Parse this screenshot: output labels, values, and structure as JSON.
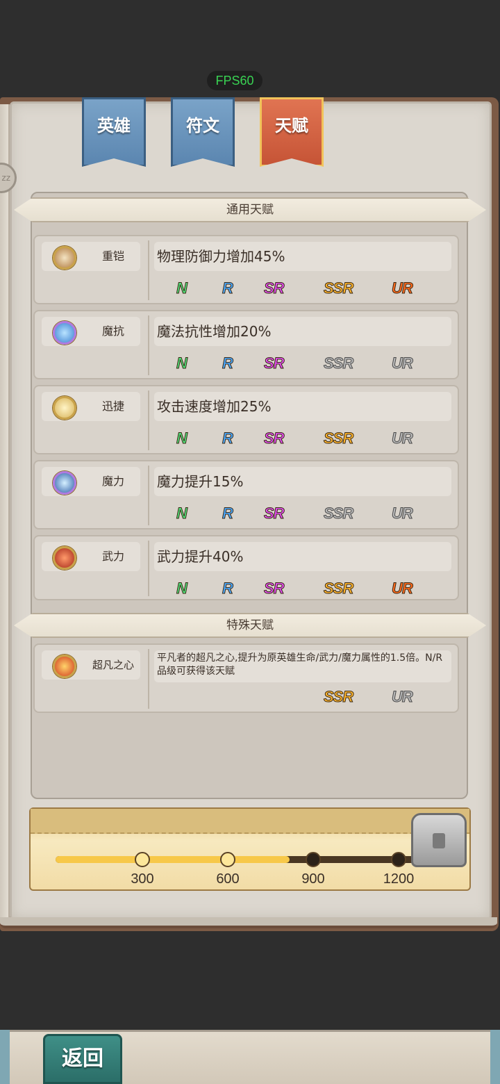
{
  "fps": "FPS60",
  "tabs": [
    {
      "label": "英雄",
      "active": false
    },
    {
      "label": "符文",
      "active": false
    },
    {
      "label": "天赋",
      "active": true
    }
  ],
  "sections": {
    "general": "通用天赋",
    "special": "特殊天赋"
  },
  "general_talents": [
    {
      "icon": "armor-icon",
      "name": "重铠",
      "desc": "物理防御力增加45%"
    },
    {
      "icon": "magic-shield-icon",
      "name": "魔抗",
      "desc": "魔法抗性增加20%"
    },
    {
      "icon": "swift-icon",
      "name": "迅捷",
      "desc": "攻击速度增加25%"
    },
    {
      "icon": "magic-power-icon",
      "name": "魔力",
      "desc": "魔力提升15%"
    },
    {
      "icon": "martial-icon",
      "name": "武力",
      "desc": "武力提升40%"
    }
  ],
  "special_talents": [
    {
      "icon": "heart-icon",
      "name": "超凡之心",
      "desc": "平凡者的超凡之心,提升为原英雄生命/武力/魔力属性的1.5倍。N/R品级可获得该天赋"
    }
  ],
  "rarity_labels": {
    "n": "N",
    "r": "R",
    "sr": "SR",
    "ssr": "SSR",
    "ur": "UR"
  },
  "progress": {
    "milestones": [
      "300",
      "600",
      "900",
      "1200"
    ],
    "fill_fraction": 0.64
  },
  "bottom": {
    "back_label": "返回"
  },
  "side_badge": "zz"
}
